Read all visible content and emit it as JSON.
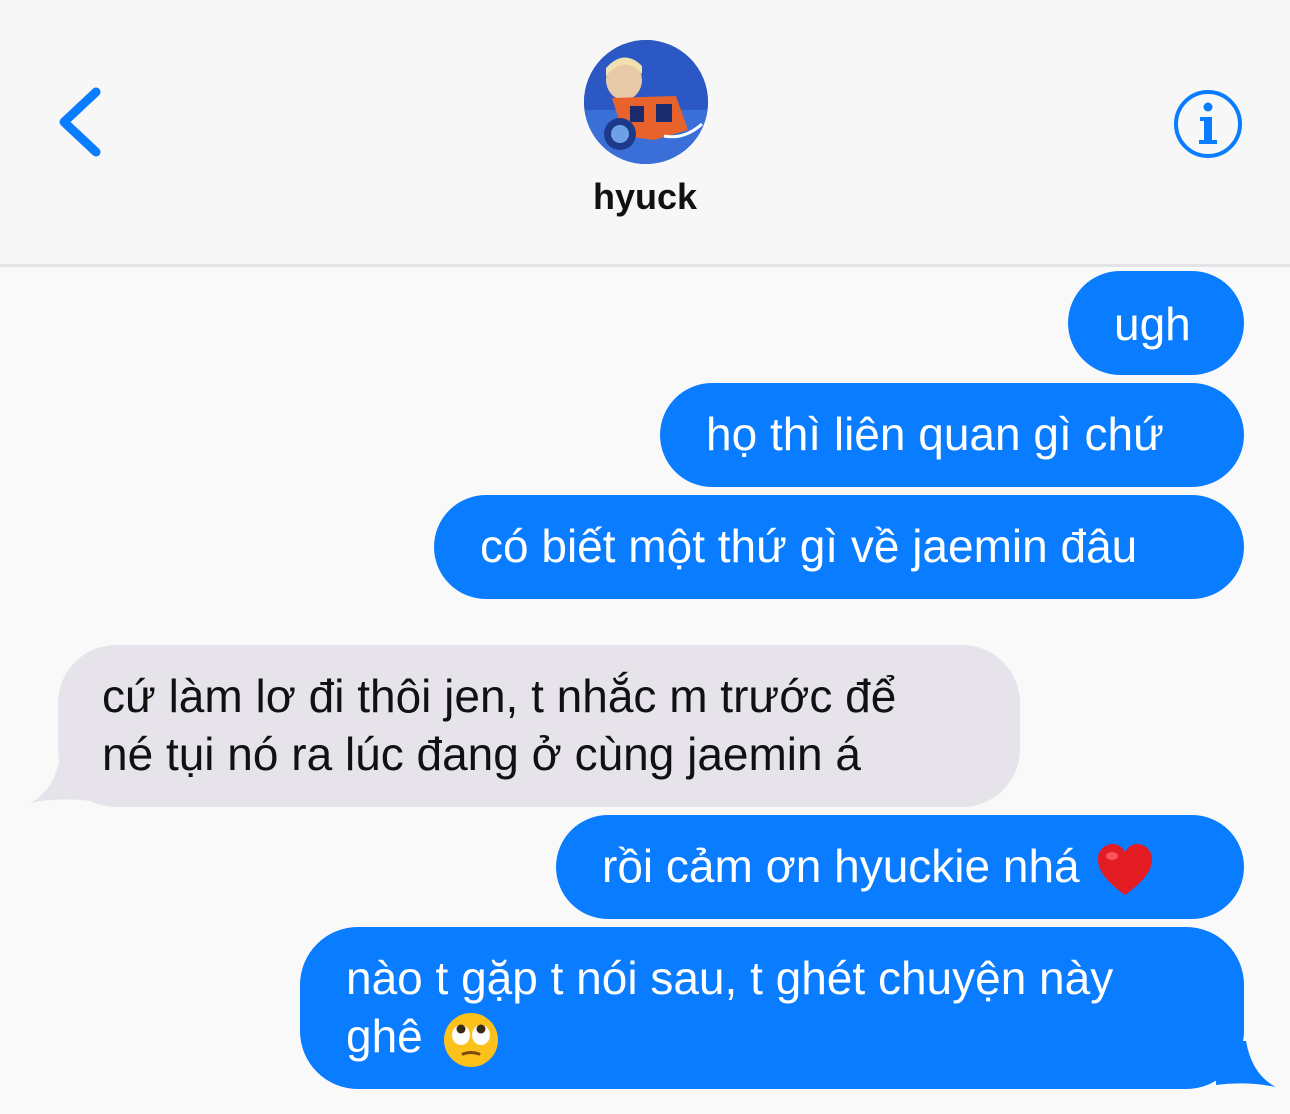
{
  "header": {
    "contact_name": "hyuck",
    "back_icon": "chevron-left-icon",
    "info_icon": "info-circle-icon",
    "avatar": "contact-avatar-photo",
    "accent_color": "#0a7cff"
  },
  "messages": [
    {
      "direction": "sent",
      "text": "ugh"
    },
    {
      "direction": "sent",
      "text": "họ thì liên quan gì chứ"
    },
    {
      "direction": "sent",
      "text": "có biết một thứ gì về jaemin đâu"
    },
    {
      "direction": "received",
      "line1": "cứ làm lơ đi thôi jen, t nhắc m trước để",
      "line2": "né tụi nó ra lúc đang ở cùng jaemin á"
    },
    {
      "direction": "sent",
      "text": "rồi cảm ơn hyuckie nhá",
      "emoji": "red-heart-icon"
    },
    {
      "direction": "sent",
      "line1": "nào t gặp t nói sau, t ghét chuyện này",
      "line2": "ghê",
      "emoji": "eye-roll-emoji-icon"
    }
  ],
  "colors": {
    "sent_bubble": "#0a7cff",
    "received_bubble": "#e6e4ea"
  }
}
